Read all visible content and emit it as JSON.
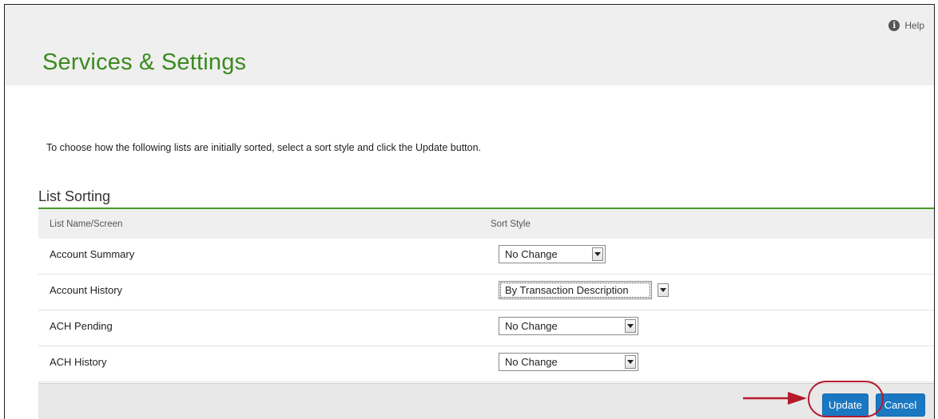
{
  "header": {
    "help_label": "Help",
    "help_icon": "info-icon",
    "title": "Services & Settings"
  },
  "instructions": "To choose how the following lists are initially sorted, select a sort style and click the Update button.",
  "list_sorting": {
    "title": "List Sorting",
    "columns": [
      "List Name/Screen",
      "Sort Style"
    ],
    "rows": [
      {
        "name": "Account Summary",
        "sort_style": "No Change"
      },
      {
        "name": "Account History",
        "sort_style": "By Transaction Description"
      },
      {
        "name": "ACH Pending",
        "sort_style": "No Change"
      },
      {
        "name": "ACH History",
        "sort_style": "No Change"
      }
    ]
  },
  "footer": {
    "update_label": "Update",
    "cancel_label": "Cancel"
  },
  "colors": {
    "title_green": "#3b8a1e",
    "rule_green": "#4a9a2a",
    "button_blue": "#1a78c2",
    "annotation_red": "#b51a2c"
  }
}
